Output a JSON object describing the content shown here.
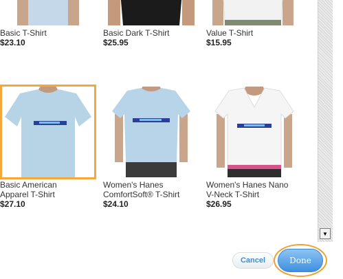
{
  "products": [
    {
      "name": "Basic T-Shirt",
      "price": "$23.10",
      "shirt_color": "#c4d8ea",
      "model": "plain"
    },
    {
      "name": "Basic Dark T-Shirt",
      "price": "$25.95",
      "shirt_color": "#1b1b1b",
      "model": "plain"
    },
    {
      "name": "Value T-Shirt",
      "price": "$15.95",
      "shirt_color": "#f2f2f2",
      "model": "plain"
    },
    {
      "name": "Basic American\nApparel T-Shirt",
      "price": "$27.10",
      "shirt_color": "#b7d3e6",
      "model": "mens",
      "selected": true
    },
    {
      "name": "Women's Hanes\nComfortSoft® T-Shirt",
      "price": "$24.10",
      "shirt_color": "#b8d4e8",
      "model": "womens"
    },
    {
      "name": "Women's Hanes Nano\nV-Neck T-Shirt",
      "price": "$26.95",
      "shirt_color": "#f5f5f5",
      "model": "vneck"
    }
  ],
  "footer": {
    "cancel_label": "Cancel",
    "done_label": "Done"
  },
  "colors": {
    "selection_border": "#f4a73a",
    "done_button": "#4d9be6",
    "cancel_text": "#3a8fd6",
    "print_band": "#2a3f9a"
  }
}
